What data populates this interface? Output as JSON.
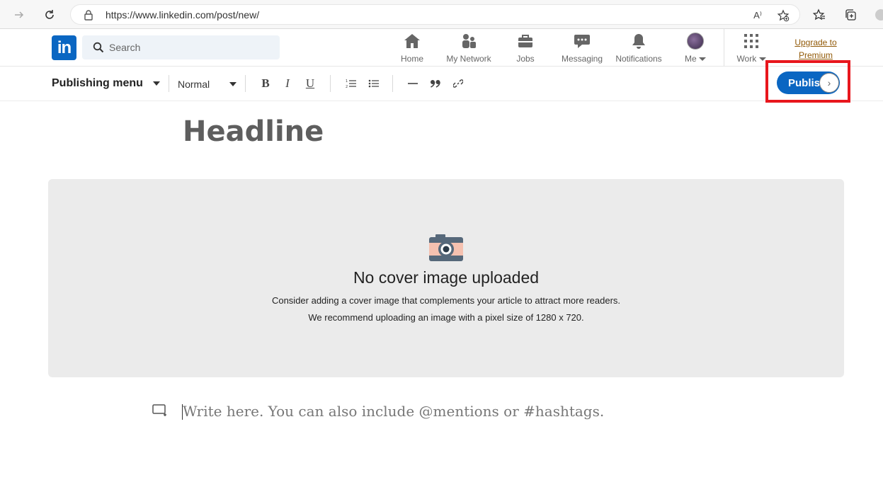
{
  "browser": {
    "url": "https://www.linkedin.com/post/new/",
    "read_aloud_label": "A⁾"
  },
  "nav": {
    "logo_text": "in",
    "search_placeholder": "Search",
    "items": [
      {
        "label": "Home",
        "icon": "home-icon"
      },
      {
        "label": "My Network",
        "icon": "network-icon"
      },
      {
        "label": "Jobs",
        "icon": "briefcase-icon"
      },
      {
        "label": "Messaging",
        "icon": "chat-bubble-icon"
      },
      {
        "label": "Notifications",
        "icon": "bell-icon"
      },
      {
        "label": "Me",
        "icon": "avatar"
      },
      {
        "label": "Work",
        "icon": "grid-icon"
      }
    ],
    "upgrade_line1": "Upgrade to",
    "upgrade_line2": "Premium"
  },
  "toolbar": {
    "publishing_menu": "Publishing menu",
    "text_style": "Normal",
    "bold": "B",
    "italic": "I",
    "underline": "U",
    "publish": "Publish",
    "publish_chevron": "›"
  },
  "editor": {
    "headline_placeholder": "Headline",
    "cover_title": "No cover image uploaded",
    "cover_desc_1": "Consider adding a cover image that complements your article to attract more readers.",
    "cover_desc_2": "We recommend uploading an image with a pixel size of 1280 x 720.",
    "body_placeholder": "Write here. You can also include @mentions or #hashtags."
  },
  "colors": {
    "linkedin_blue": "#0a66c2",
    "highlight_red": "#e8161d",
    "premium_gold": "#915907"
  }
}
